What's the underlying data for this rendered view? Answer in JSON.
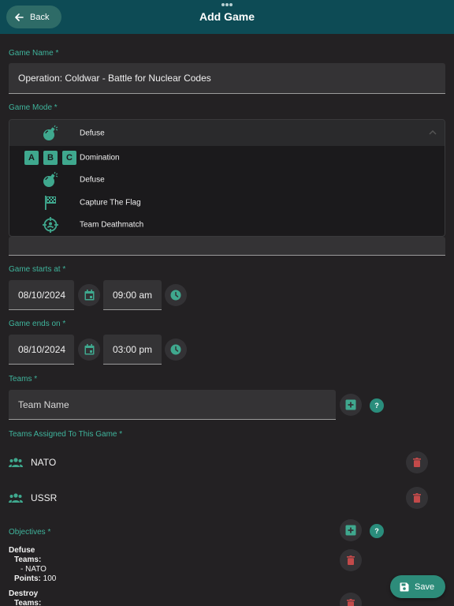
{
  "header": {
    "title": "Add Game",
    "back_label": "Back",
    "accent": "#0d4b55"
  },
  "form": {
    "game_name_label": "Game Name *",
    "game_name_value": "Operation: Coldwar - Battle for Nuclear Codes",
    "game_mode_label": "Game Mode *",
    "game_mode_selected": "Defuse",
    "game_mode_options": [
      {
        "label": "Domination",
        "icon": "abc-letters-icon"
      },
      {
        "label": "Defuse",
        "icon": "bomb-icon"
      },
      {
        "label": "Capture The Flag",
        "icon": "flag-icon"
      },
      {
        "label": "Team Deathmatch",
        "icon": "crosshair-person-icon"
      }
    ],
    "domination_letters": [
      "A",
      "B",
      "C"
    ],
    "starts_label": "Game starts at *",
    "starts_date": "08/10/2024",
    "starts_time": "09:00 am",
    "ends_label": "Game ends on *",
    "ends_date": "08/10/2024",
    "ends_time": "03:00 pm",
    "teams_label": "Teams *",
    "team_name_placeholder": "Team Name",
    "help_symbol": "?",
    "assigned_label": "Teams Assigned To This Game *",
    "assigned_teams": [
      "NATO",
      "USSR"
    ],
    "objectives_label": "Objectives *",
    "objectives": [
      {
        "title": "Defuse",
        "teams_label": "Teams:",
        "team_line": "- NATO",
        "points_label": "Points:",
        "points_value": "100"
      },
      {
        "title": "Destroy",
        "teams_label": "Teams:"
      }
    ]
  },
  "footer": {
    "save_label": "Save"
  }
}
